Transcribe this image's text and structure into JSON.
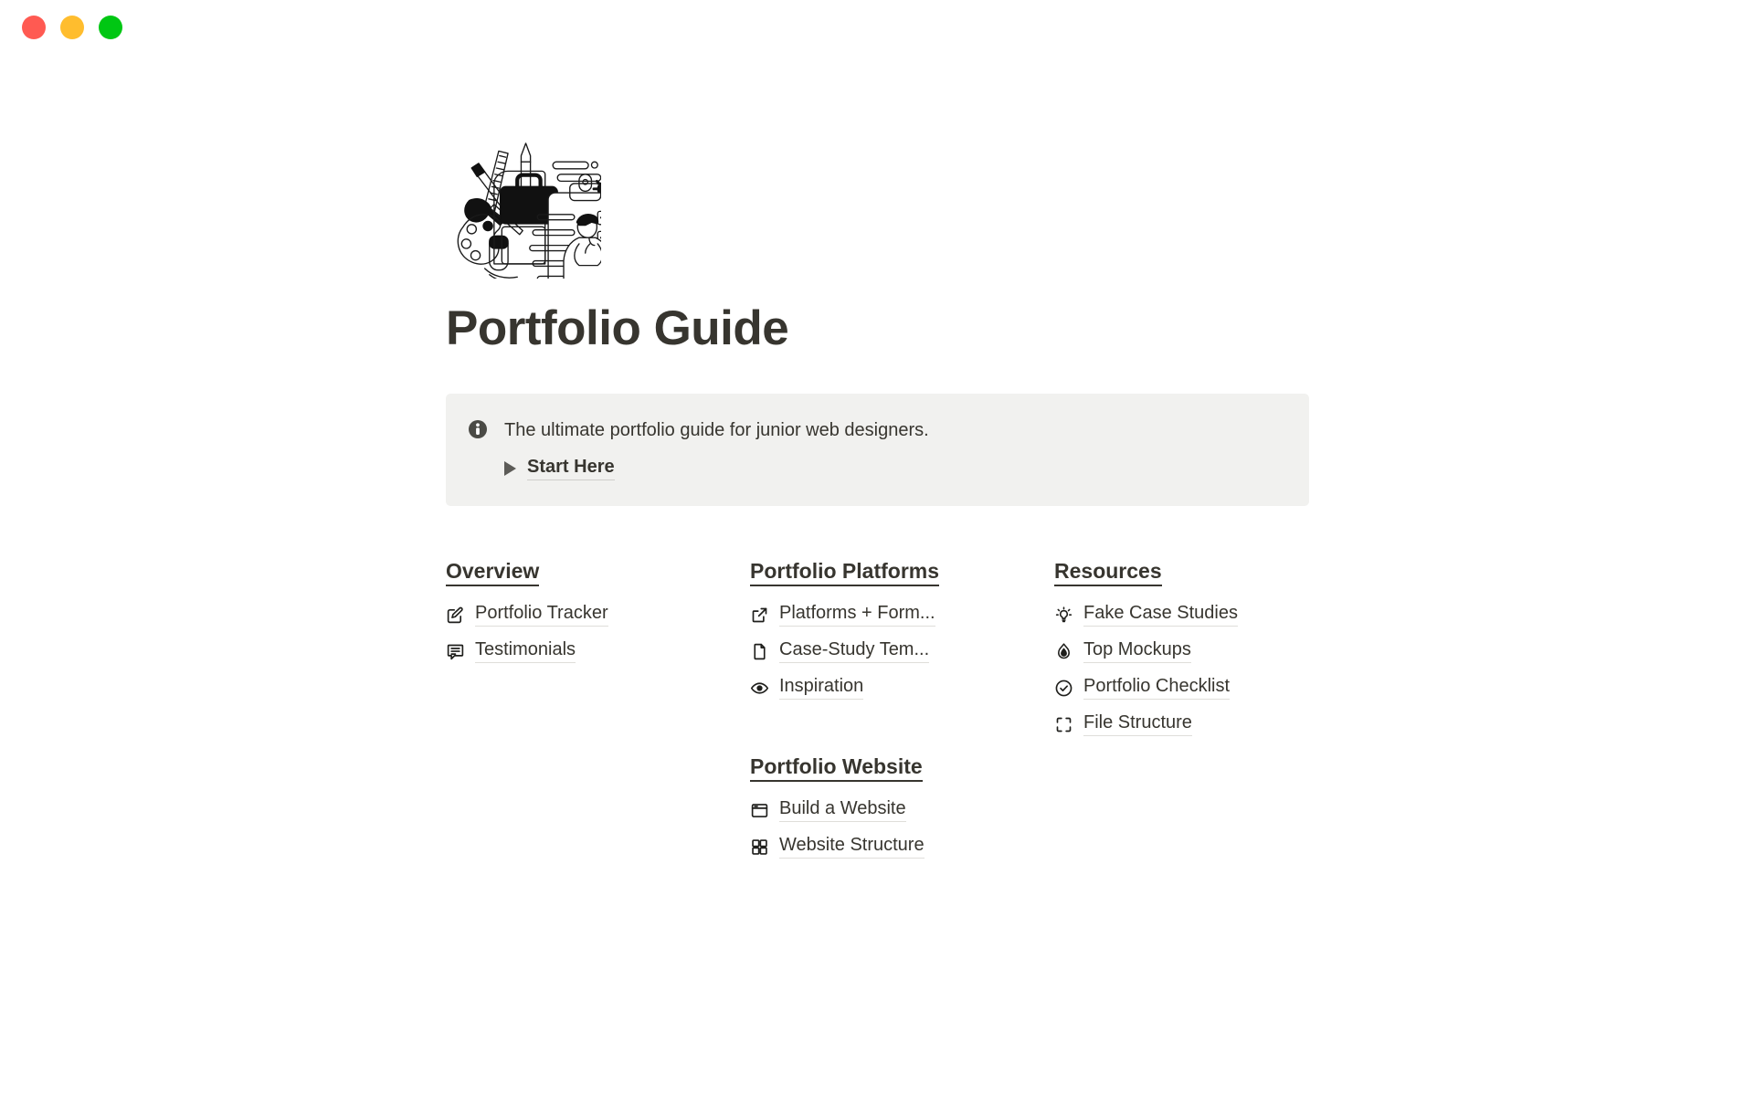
{
  "window": {
    "controls": [
      {
        "name": "close",
        "color": "#ff5a52"
      },
      {
        "name": "minimize",
        "color": "#ffbd2e"
      },
      {
        "name": "maximize",
        "color": "#00c713"
      }
    ]
  },
  "cover": {
    "icon": "portfolio-illustration",
    "description": "Black and white line illustration of art supplies, briefcase, clipboard with checklist and a standing person"
  },
  "page": {
    "title": "Portfolio Guide"
  },
  "callout": {
    "icon": "info-icon",
    "text": "The ultimate portfolio guide for junior web designers.",
    "toggle": {
      "icon": "triangle-right-icon",
      "label": "Start Here",
      "expanded": false
    },
    "background_color": "#f1f1ef"
  },
  "columns": [
    {
      "id": "column-left",
      "sections": [
        {
          "heading": "Overview",
          "links": [
            {
              "icon": "pencil-square-icon",
              "label": "Portfolio Tracker"
            },
            {
              "icon": "message-square-text-icon",
              "label": "Testimonials"
            }
          ]
        }
      ]
    },
    {
      "id": "column-middle",
      "sections": [
        {
          "heading": "Portfolio Platforms",
          "links": [
            {
              "icon": "external-link-icon",
              "label": "Platforms + Form..."
            },
            {
              "icon": "file-icon",
              "label": "Case-Study Tem..."
            },
            {
              "icon": "eye-icon",
              "label": "Inspiration"
            }
          ]
        },
        {
          "heading": "Portfolio Website",
          "links": [
            {
              "icon": "browser-window-icon",
              "label": "Build a Website"
            },
            {
              "icon": "grid-four-icon",
              "label": "Website Structure"
            }
          ]
        }
      ]
    },
    {
      "id": "column-right",
      "sections": [
        {
          "heading": "Resources",
          "links": [
            {
              "icon": "lightbulb-icon",
              "label": "Fake Case Studies"
            },
            {
              "icon": "flame-icon",
              "label": "Top Mockups"
            },
            {
              "icon": "check-circle-icon",
              "label": "Portfolio Checklist"
            },
            {
              "icon": "frame-corners-icon",
              "label": "File Structure"
            }
          ]
        }
      ]
    }
  ],
  "colors": {
    "text": "#37352f",
    "underline": "#dfdeda",
    "callout_bg": "#f1f1ef",
    "page_bg": "#ffffff"
  }
}
